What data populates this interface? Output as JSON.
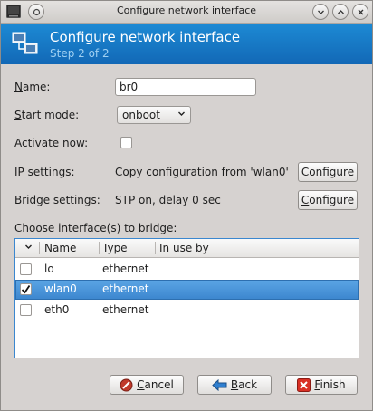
{
  "window": {
    "title": "Configure network interface",
    "controls": {
      "minimize": "⌄",
      "maximize": "^",
      "close": "×"
    }
  },
  "banner": {
    "title": "Configure network interface",
    "subtitle": "Step 2 of 2",
    "icon": "network-interface-icon"
  },
  "form": {
    "name_label_u": "N",
    "name_label_rest": "ame:",
    "name_value": "br0",
    "start_mode_label_u": "S",
    "start_mode_label_rest": "tart mode:",
    "start_mode_value": "onboot",
    "activate_label_u": "A",
    "activate_label_rest": "ctivate now:",
    "activate_checked": false,
    "ip_label": "IP settings:",
    "ip_value": "Copy configuration from 'wlan0'",
    "ip_button_u": "C",
    "ip_button_rest": "onfigure",
    "bridge_label": "Bridge settings:",
    "bridge_value": "STP on, delay 0 sec",
    "bridge_button_u": "C",
    "bridge_button_rest": "onfigure",
    "choose_label": "Choose interface(s) to bridge:"
  },
  "table": {
    "columns": [
      "Name",
      "Type",
      "In use by"
    ],
    "rows": [
      {
        "name": "lo",
        "type": "ethernet",
        "in_use_by": "",
        "checked": false,
        "selected": false
      },
      {
        "name": "wlan0",
        "type": "ethernet",
        "in_use_by": "",
        "checked": true,
        "selected": true
      },
      {
        "name": "eth0",
        "type": "ethernet",
        "in_use_by": "",
        "checked": false,
        "selected": false
      }
    ]
  },
  "buttons": {
    "cancel_u": "C",
    "cancel_rest": "ancel",
    "back_u": "B",
    "back_rest": "ack",
    "finish_u": "F",
    "finish_rest": "inish"
  },
  "colors": {
    "banner": "#1874c2",
    "selection": "#3d87cf",
    "cancel_icon": "#c0392b",
    "back_icon": "#2f7fd0",
    "finish_icon": "#d93025"
  }
}
